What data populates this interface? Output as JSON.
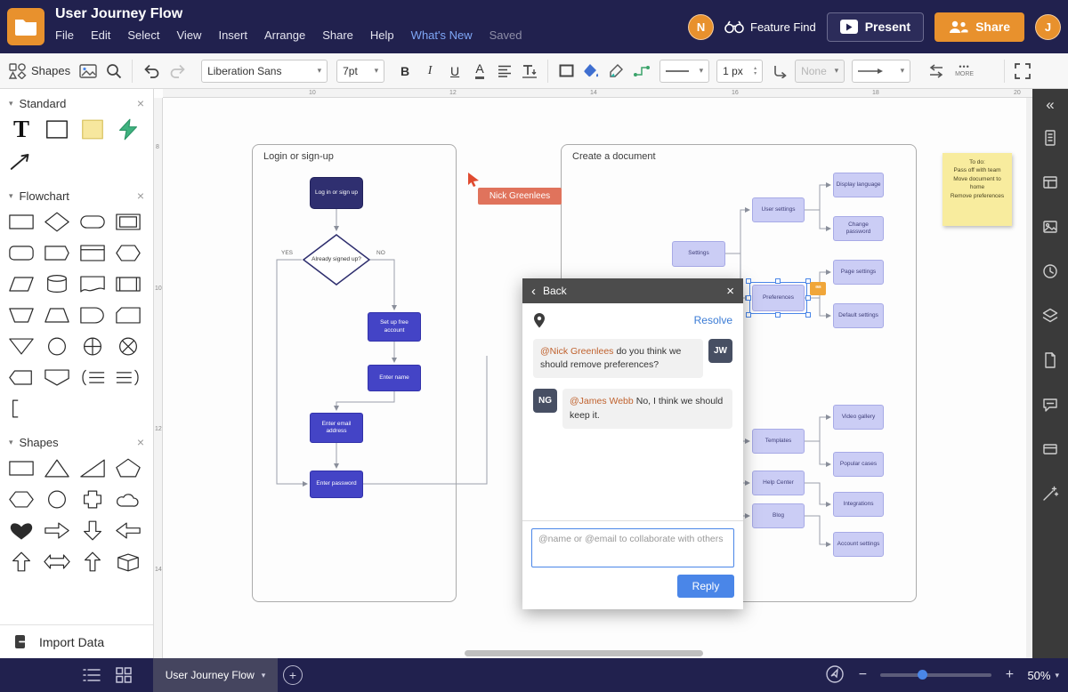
{
  "topbar": {
    "title": "User Journey Flow",
    "menus": [
      "File",
      "Edit",
      "Select",
      "View",
      "Insert",
      "Arrange",
      "Share",
      "Help",
      "What's New"
    ],
    "saved": "Saved",
    "avatar_left": "N",
    "feature_find": "Feature Find",
    "present": "Present",
    "share": "Share",
    "avatar_right": "J"
  },
  "toolbar": {
    "shapes_label": "Shapes",
    "font_family": "Liberation Sans",
    "font_size": "7pt",
    "bold": "B",
    "italic": "I",
    "underline": "U",
    "text_color": "A",
    "text_tool": "T",
    "line_weight": "1 px",
    "none_label": "None",
    "more_label": "MORE"
  },
  "sidebar": {
    "sections": [
      {
        "title": "Standard"
      },
      {
        "title": "Flowchart"
      },
      {
        "title": "Shapes"
      }
    ],
    "import_label": "Import Data"
  },
  "canvas": {
    "ruler_top": [
      "10",
      "12",
      "14",
      "16",
      "18",
      "20"
    ],
    "ruler_left": [
      "8",
      "10",
      "12",
      "14"
    ],
    "container1_title": "Login or sign-up",
    "container2_title": "Create a document",
    "flow1": {
      "login": "Log in or sign up",
      "decision": "Already signed up?",
      "yes": "YES",
      "no": "NO",
      "setup": "Set up free account",
      "name": "Enter name",
      "email": "Enter email address",
      "password": "Enter password"
    },
    "flow2": {
      "settings": "Settings",
      "user_settings": "User settings",
      "display_language": "Display language",
      "change_password": "Change password",
      "page_settings": "Page settings",
      "preferences": "Preferences",
      "default_settings": "Default settings",
      "templates": "Templates",
      "help_center": "Help Center",
      "blog": "Blog",
      "video_gallery": "Video gallery",
      "popular_cases": "Popular cases",
      "integrations": "Integrations",
      "account_settings": "Account settings"
    },
    "sticky_note": {
      "lines": [
        "To do:",
        "Pass off with team",
        "Move document to home",
        "Remove preferences"
      ]
    },
    "collaborator": "Nick Greenlees"
  },
  "popup": {
    "back": "Back",
    "resolve": "Resolve",
    "comments": [
      {
        "avatar": "JW",
        "mention": "@Nick Greenlees",
        "text": "do you think we should remove preferences?"
      },
      {
        "avatar": "NG",
        "mention": "@James Webb",
        "text": "No, I think we should keep it."
      }
    ],
    "placeholder": "@name or @email to collaborate with others",
    "reply": "Reply"
  },
  "bottombar": {
    "doc_tab": "User Journey Flow",
    "zoom": "50%"
  },
  "icons": {
    "caret_down": "▾",
    "caret_up": "▴",
    "more_dots": "•••",
    "close": "×",
    "back": "‹",
    "collapse": "«",
    "quote": "““",
    "plus": "+",
    "minus": "−"
  },
  "colors": {
    "topbar_bg": "#21214e",
    "accent_orange": "#e8912d",
    "node_navy": "#2f2f70",
    "node_blue": "#4444c6",
    "node_lavender": "#cbcdf5",
    "reply_blue": "#4a86e8",
    "sticky_yellow": "#f8ec9e",
    "collaborator_red": "#e0735c"
  }
}
